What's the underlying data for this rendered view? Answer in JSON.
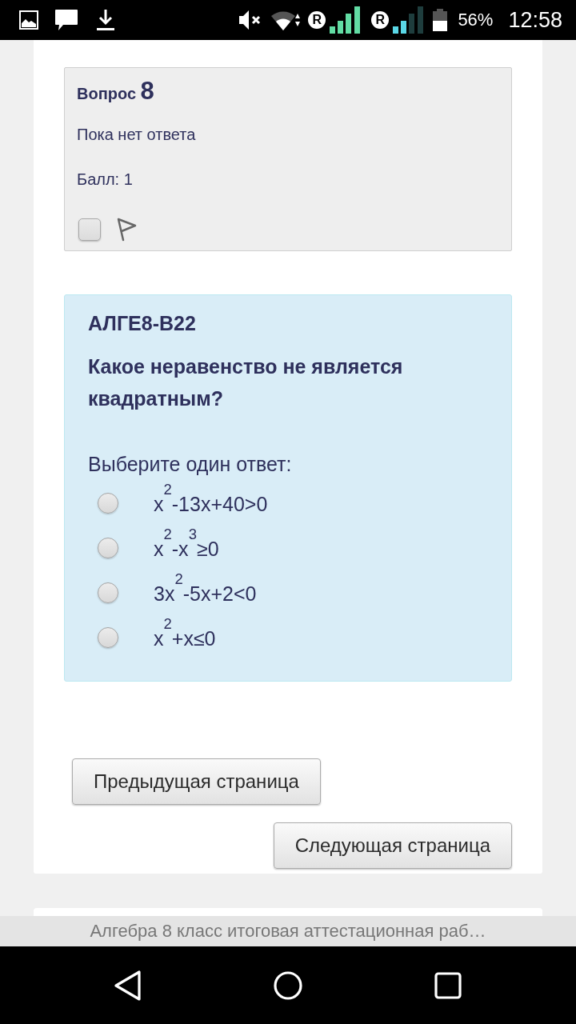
{
  "status_bar": {
    "sims": [
      {
        "roaming": "R"
      },
      {
        "roaming": "R"
      }
    ],
    "battery": "56%",
    "time": "12:58"
  },
  "question_info": {
    "label": "Вопрос",
    "number": "8",
    "status": "Пока нет ответа",
    "mark": "Балл: 1",
    "flagged": false
  },
  "formulation": {
    "code": "АЛГЕ8-В22",
    "question": "Какое неравенство не является квадратным?",
    "prompt": "Выберите один ответ:",
    "options": [
      {
        "text": "x$^{2}$-13x+40>0",
        "selected": false
      },
      {
        "text": "x$^{2}$-x$^{3}$≥0",
        "selected": false
      },
      {
        "text": "3x$^{2}$-5x+2<0",
        "selected": false
      },
      {
        "text": "x$^{2}$+x≤0",
        "selected": false
      }
    ]
  },
  "navigation": {
    "previous": "Предыдущая страница",
    "next": "Следующая страница"
  },
  "page_title": "Алгебра 8 класс итоговая аттестационная раб…"
}
